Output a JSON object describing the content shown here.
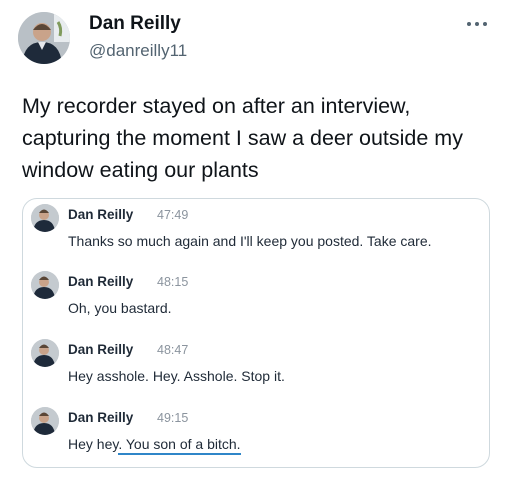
{
  "author": {
    "name": "Dan Reilly",
    "handle": "@danreilly11"
  },
  "tweet": {
    "text": "My recorder stayed on after an interview, capturing the moment I saw a deer outside my window eating our plants"
  },
  "transcript": {
    "messages": [
      {
        "speaker": "Dan Reilly",
        "time": "47:49",
        "text": "Thanks so much again and I'll keep you posted. Take care.",
        "highlight": ""
      },
      {
        "speaker": "Dan Reilly",
        "time": "48:15",
        "text": "Oh, you bastard.",
        "highlight": ""
      },
      {
        "speaker": "Dan Reilly",
        "time": "48:47",
        "text": "Hey asshole. Hey. Asshole. Stop it.",
        "highlight": ""
      },
      {
        "speaker": "Dan Reilly",
        "time": "49:15",
        "text": "Hey hey",
        "highlight": ". You son of a bitch."
      }
    ]
  },
  "colors": {
    "highlight_underline": "#2f86c8",
    "handle": "#536471"
  },
  "icons": {
    "more": "more-options-icon"
  }
}
